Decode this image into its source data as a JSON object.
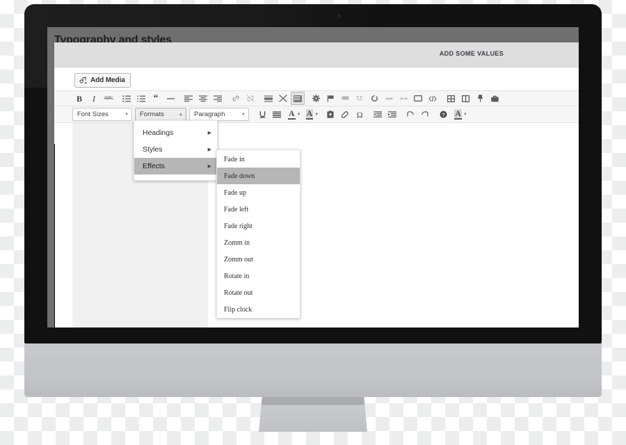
{
  "page": {
    "title": "Typography and styles"
  },
  "app_header": {
    "label": "ADD SOME VALUES"
  },
  "editor": {
    "add_media_button": "Add Media",
    "add_media_icon": "media-photo-music-icon",
    "toolbar_row1": [
      {
        "name": "bold",
        "glyph": "B",
        "title": "Bold"
      },
      {
        "name": "italic",
        "glyph": "I",
        "title": "Italic"
      },
      {
        "name": "strikethrough",
        "glyph": "ABC",
        "title": "Strikethrough"
      },
      {
        "name": "bulleted-list",
        "glyph": "",
        "title": "Bulleted list"
      },
      {
        "name": "numbered-list",
        "glyph": "",
        "title": "Numbered list"
      },
      {
        "name": "blockquote",
        "glyph": "““",
        "title": "Blockquote"
      },
      {
        "name": "horizontal-rule",
        "glyph": "–",
        "title": "Horizontal line"
      },
      {
        "name": "align-left",
        "glyph": "",
        "title": "Align left"
      },
      {
        "name": "align-center",
        "glyph": "",
        "title": "Align center"
      },
      {
        "name": "align-right",
        "glyph": "",
        "title": "Align right"
      },
      {
        "name": "insert-link",
        "glyph": "",
        "title": "Insert/edit link"
      },
      {
        "name": "unlink",
        "glyph": "",
        "title": "Remove link"
      },
      {
        "name": "read-more",
        "glyph": "",
        "title": "Insert Read More tag"
      },
      {
        "name": "distraction-free",
        "glyph": "",
        "title": "Distraction-free writing"
      },
      {
        "name": "toggle-toolbar",
        "glyph": "",
        "title": "Toolbar toggle",
        "active": true
      },
      {
        "name": "settings-gear",
        "glyph": "",
        "title": "Settings"
      },
      {
        "name": "flag",
        "glyph": "",
        "title": "Flag"
      },
      {
        "name": "button-shortcode",
        "glyph": "",
        "title": "Button"
      },
      {
        "name": "quote-shortcode",
        "glyph": "",
        "title": "Quote"
      },
      {
        "name": "circle-progress",
        "glyph": "",
        "title": "Circle"
      },
      {
        "name": "bar-shortcode",
        "glyph": "",
        "title": "Progress bar"
      },
      {
        "name": "columns-two",
        "glyph": "",
        "title": "Two columns"
      },
      {
        "name": "box-shortcode",
        "glyph": "",
        "title": "Box"
      },
      {
        "name": "source-code",
        "glyph": "",
        "title": "Source code"
      },
      {
        "name": "grid-layout",
        "glyph": "",
        "title": "Grid"
      },
      {
        "name": "split-layout",
        "glyph": "",
        "title": "Split layout"
      },
      {
        "name": "pin",
        "glyph": "",
        "title": "Pin"
      },
      {
        "name": "briefcase",
        "glyph": "",
        "title": "Portfolio"
      }
    ],
    "toolbar_row2": {
      "font_sizes_label": "Font Sizes",
      "formats_label": "Formats",
      "paragraph_label": "Paragraph",
      "buttons": [
        {
          "name": "underline",
          "title": "Underline"
        },
        {
          "name": "justify",
          "title": "Justify"
        },
        {
          "name": "text-color",
          "title": "Text color"
        },
        {
          "name": "background-color",
          "title": "Background color"
        },
        {
          "name": "paste-as-text",
          "title": "Paste as text"
        },
        {
          "name": "clear-formatting",
          "title": "Clear formatting"
        },
        {
          "name": "special-character",
          "title": "Special character"
        },
        {
          "name": "outdent",
          "title": "Decrease indent"
        },
        {
          "name": "indent",
          "title": "Increase indent"
        },
        {
          "name": "undo",
          "title": "Undo"
        },
        {
          "name": "redo",
          "title": "Redo"
        },
        {
          "name": "keyboard-help",
          "title": "Keyboard shortcuts"
        },
        {
          "name": "more-text-color",
          "title": "Text color"
        }
      ]
    }
  },
  "menus": {
    "formats": {
      "items": [
        {
          "label": "Headings",
          "has_submenu": true,
          "selected": false
        },
        {
          "label": "Styles",
          "has_submenu": true,
          "selected": false
        },
        {
          "label": "Effects",
          "has_submenu": true,
          "selected": true
        }
      ]
    },
    "effects": {
      "items": [
        {
          "label": "Fade in",
          "selected": false
        },
        {
          "label": "Fade down",
          "selected": true
        },
        {
          "label": "Fade up",
          "selected": false
        },
        {
          "label": "Fade left",
          "selected": false
        },
        {
          "label": "Fade right",
          "selected": false
        },
        {
          "label": "Zomm in",
          "selected": false
        },
        {
          "label": "Zomm out",
          "selected": false
        },
        {
          "label": "Rotate in",
          "selected": false
        },
        {
          "label": "Rotate out",
          "selected": false
        },
        {
          "label": "Flip clock",
          "selected": false
        }
      ]
    }
  },
  "colors": {
    "bezel": "#111111",
    "screen_backdrop": "#6f6f6f",
    "app_header": "#dededf",
    "toolbar": "#f6f6f6",
    "menu_highlight": "#b6b6b6",
    "stand": "#c4c6c9",
    "canvas_panel": "#f1f1f1"
  }
}
